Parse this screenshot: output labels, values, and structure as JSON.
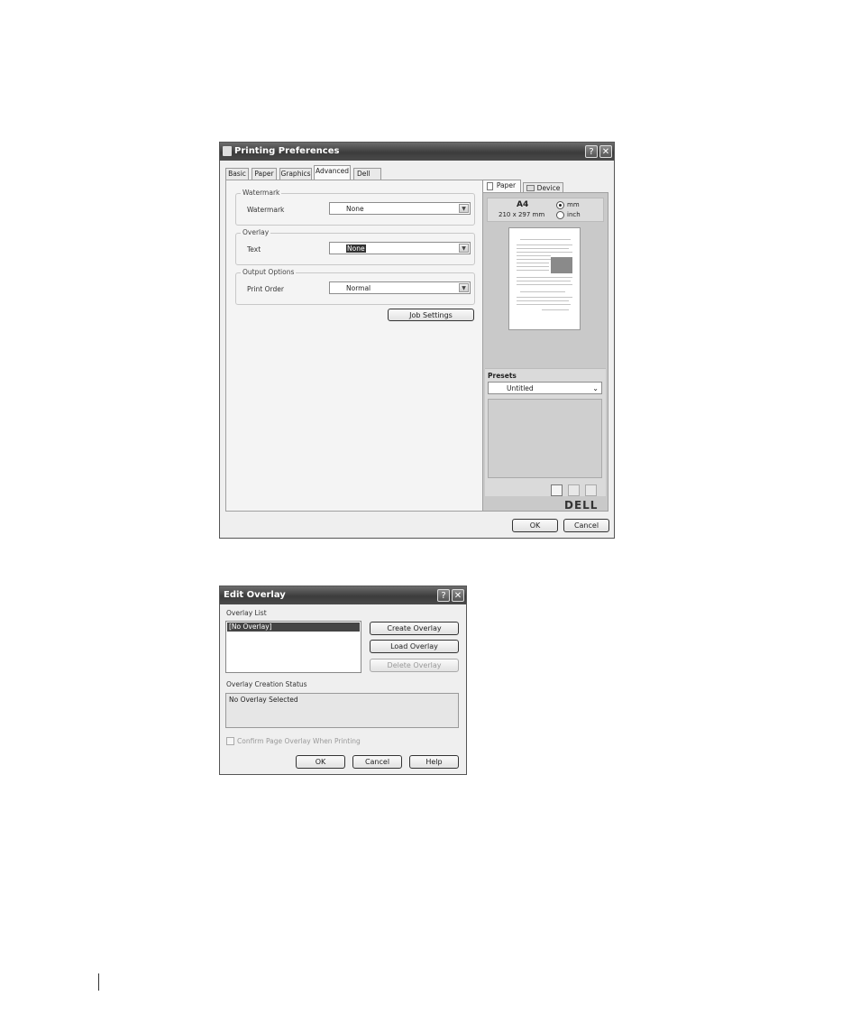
{
  "printing_preferences": {
    "title": "Printing Preferences",
    "help_glyph": "?",
    "close_glyph": "✕",
    "tabs": [
      "Basic",
      "Paper",
      "Graphics",
      "Advanced",
      "Dell"
    ],
    "active_tab": "Advanced",
    "watermark": {
      "group": "Watermark",
      "label": "Watermark",
      "value": "None"
    },
    "overlay": {
      "group": "Overlay",
      "label": "Text",
      "value": "None"
    },
    "output": {
      "group": "Output Options",
      "label": "Print Order",
      "value": "Normal"
    },
    "job_settings": "Job Settings",
    "preview_tabs": [
      "Paper",
      "Device"
    ],
    "paper_name": "A4",
    "paper_size": "210 x 297 mm",
    "unit_mm": "mm",
    "unit_inch": "inch",
    "unit_selected": "mm",
    "presets_label": "Presets",
    "preset_value": "Untitled",
    "logo": "DELL",
    "ok": "OK",
    "cancel": "Cancel"
  },
  "edit_overlay": {
    "title": "Edit Overlay",
    "help_glyph": "?",
    "close_glyph": "✕",
    "list_label": "Overlay List",
    "list_items": [
      "[No Overlay]"
    ],
    "create": "Create Overlay",
    "load": "Load Overlay",
    "delete": "Delete Overlay",
    "status_label": "Overlay Creation Status",
    "status_text": "No Overlay Selected",
    "confirm_label": "Confirm Page Overlay When Printing",
    "confirm_checked": false,
    "ok": "OK",
    "cancel": "Cancel",
    "help": "Help"
  },
  "colors": {
    "title_bar": "#4a4a4a",
    "dialog_bg": "#efefef",
    "preview_panel": "#c9c9c9",
    "selection": "#333333"
  }
}
